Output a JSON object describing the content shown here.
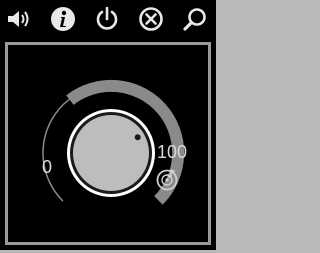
{
  "toolbar": {
    "items": [
      {
        "name": "volume",
        "icon": "speaker-icon"
      },
      {
        "name": "info",
        "icon": "info-icon"
      },
      {
        "name": "power",
        "icon": "power-icon"
      },
      {
        "name": "close",
        "icon": "close-circle-icon"
      },
      {
        "name": "search",
        "icon": "magnifier-icon"
      }
    ]
  },
  "knob": {
    "min_label": "0",
    "max_label": "100",
    "level": 0.72,
    "bottom_icon": "disc-note-icon"
  },
  "colors": {
    "background": "#000000",
    "frame": "#9a9a9a",
    "knob_face": "#bdbdbd",
    "knob_ring": "#ffffff",
    "track": "#7a7a7a"
  }
}
